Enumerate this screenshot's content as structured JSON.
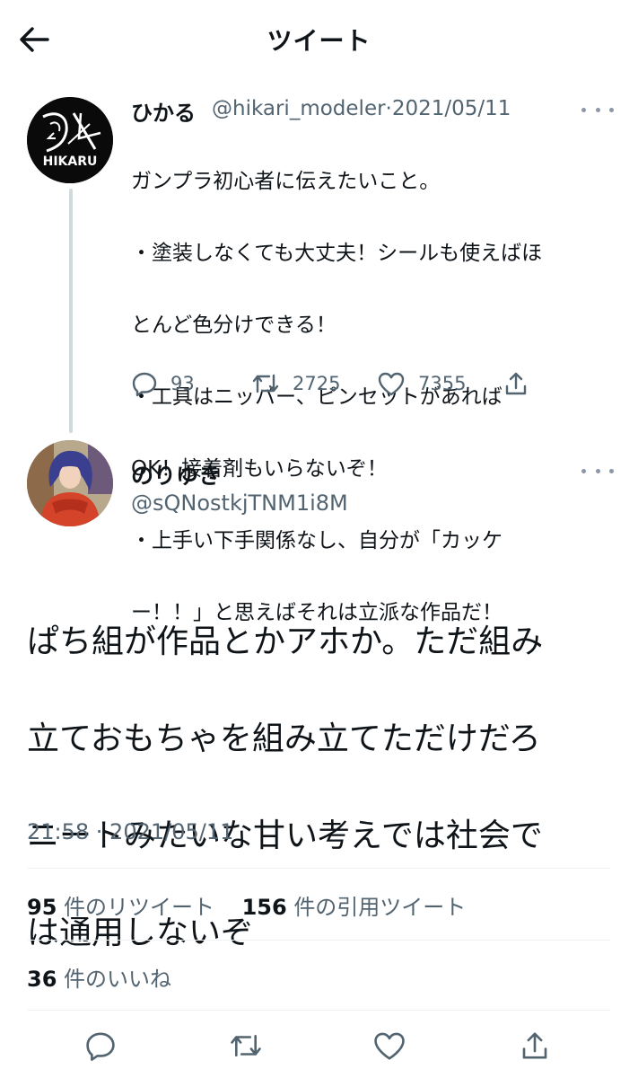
{
  "header": {
    "title": "ツイート",
    "back_icon": "arrow-left-icon"
  },
  "quoted_tweet": {
    "name": "ひかる",
    "handle": "@hikari_modeler",
    "date": "2021/05/11",
    "avatar_label": "HIKARU",
    "text": "ガンプラ初心者に伝えたいこと。\n・塗装しなくても大丈夫！シールも使えばほとんど色分けできる！\n・工具はニッパー、ピンセットがあればOK！接着剤もいらないぞ！\n・上手い下手関係なし、自分が「カッケー！！」と思えばそれは立派な作品だ！",
    "text_lines": [
      "ガンプラ初心者に伝えたいこと。",
      "・塗装しなくても大丈夫！シールも使えばほ",
      "とんど色分けできる！",
      "・工具はニッパー、ピンセットがあれば",
      "OK！接着剤もいらないぞ！",
      "・上手い下手関係なし、自分が「カッケ",
      "ー！！」と思えばそれは立派な作品だ！"
    ],
    "replies": "93",
    "retweets": "2725",
    "likes": "7355"
  },
  "tweet": {
    "name": "のりゆき",
    "handle": "@sQNostkjTNM1i8M",
    "text_lines": [
      "ぱち組が作品とかアホか。ただ組み",
      "立ておもちゃを組み立てただけだろ",
      "ニートみたいな甘い考えでは社会で",
      "は通用しないぞ"
    ],
    "timestamp": "21:58 · 2021/05/11",
    "retweet_count": "95",
    "retweet_label": "件のリツイート",
    "quote_count": "156",
    "quote_label": "件の引用ツイート",
    "like_count": "36",
    "like_label": "件のいいね"
  },
  "colors": {
    "text": "#0f1419",
    "secondary": "#536471",
    "divider": "#eff3f4",
    "thread_line": "#cfd9de"
  }
}
